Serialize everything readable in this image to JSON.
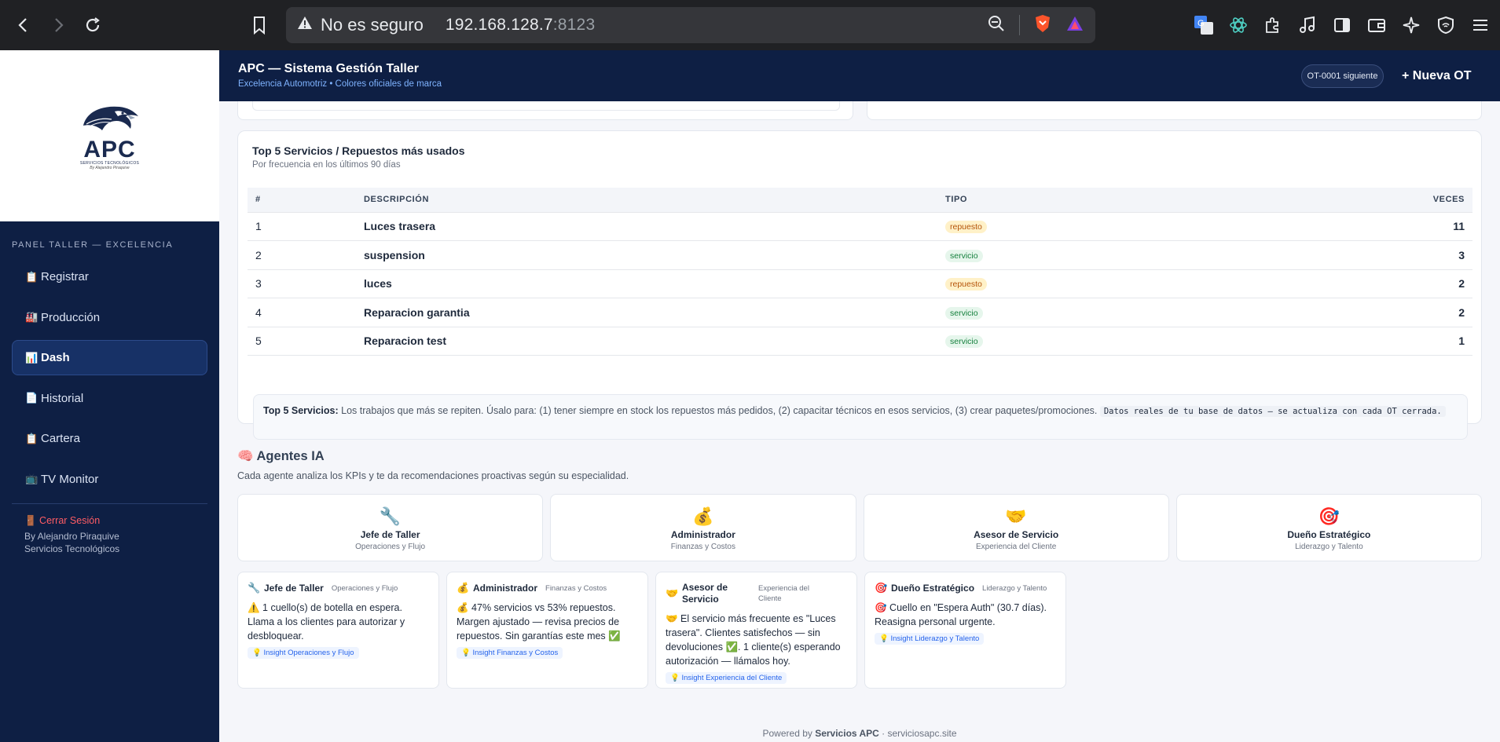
{
  "browser": {
    "insecure_label": "No es seguro",
    "url_host": "192.168.128.7",
    "url_port": ":8123"
  },
  "logo": {
    "text": "APC",
    "sub": "SERVICIOS TECNOLÓGICOS",
    "sign": "By Alejandro Piraquive"
  },
  "sidebar": {
    "section": "PANEL TALLER — EXCELENCIA",
    "items": [
      {
        "icon": "📋",
        "label": "Registrar"
      },
      {
        "icon": "🏭",
        "label": "Producción"
      },
      {
        "icon": "📊",
        "label": "Dash"
      },
      {
        "icon": "📄",
        "label": "Historial"
      },
      {
        "icon": "📋",
        "label": "Cartera"
      },
      {
        "icon": "📺",
        "label": "TV Monitor"
      }
    ],
    "logout": "🚪 Cerrar Sesión",
    "by_line1": "By Alejandro Piraquive",
    "by_line2": "Servicios Tecnológicos"
  },
  "header": {
    "title": "APC — Sistema Gestión Taller",
    "subtitle": "Excelencia Automotriz • Colores oficiales de marca",
    "ot_next": "OT-0001 siguiente",
    "new_ot": "+ Nueva OT"
  },
  "top5": {
    "title": "Top 5 Servicios / Repuestos más usados",
    "subtitle": "Por frecuencia en los últimos 90 días",
    "columns": [
      "#",
      "DESCRIPCIÓN",
      "TIPO",
      "VECES"
    ],
    "rows": [
      {
        "n": "1",
        "desc": "Luces trasera",
        "tipo": "repuesto",
        "veces": "11"
      },
      {
        "n": "2",
        "desc": "suspension",
        "tipo": "servicio",
        "veces": "3"
      },
      {
        "n": "3",
        "desc": "luces",
        "tipo": "repuesto",
        "veces": "2"
      },
      {
        "n": "4",
        "desc": "Reparacion garantia",
        "tipo": "servicio",
        "veces": "2"
      },
      {
        "n": "5",
        "desc": "Reparacion test",
        "tipo": "servicio",
        "veces": "1"
      }
    ],
    "note_label": "Top 5 Servicios:",
    "note_text": " Los trabajos que más se repiten. Úsalo para: (1) tener siempre en stock los repuestos más pedidos, (2) capacitar técnicos en esos servicios, (3) crear paquetes/promociones. ",
    "note_code": "Datos reales de tu base de datos — se actualiza con cada OT cerrada."
  },
  "agents": {
    "title": "🧠 Agentes IA",
    "subtitle": "Cada agente analiza los KPIs y te da recomendaciones proactivas según su especialidad.",
    "cards": [
      {
        "icon": "🔧",
        "name": "Jefe de Taller",
        "desc": "Operaciones y Flujo"
      },
      {
        "icon": "💰",
        "name": "Administrador",
        "desc": "Finanzas y Costos"
      },
      {
        "icon": "🤝",
        "name": "Asesor de Servicio",
        "desc": "Experiencia del Cliente"
      },
      {
        "icon": "🎯",
        "name": "Dueño Estratégico",
        "desc": "Liderazgo y Talento"
      }
    ],
    "insights": [
      {
        "icon": "🔧",
        "name": "Jefe de Taller",
        "desc": "Operaciones y Flujo",
        "body": "⚠️ 1 cuello(s) de botella en espera. Llama a los clientes para autorizar y desbloquear.",
        "tag": "💡 Insight Operaciones y Flujo"
      },
      {
        "icon": "💰",
        "name": "Administrador",
        "desc": "Finanzas y Costos",
        "body": "💰 47% servicios vs 53% repuestos. Margen ajustado — revisa precios de repuestos. Sin garantías este mes ✅",
        "tag": "💡 Insight Finanzas y Costos"
      },
      {
        "icon": "🤝",
        "name": "Asesor de Servicio",
        "desc": "Experiencia del Cliente",
        "body": "🤝 El servicio más frecuente es \"Luces trasera\". Clientes satisfechos — sin devoluciones ✅. 1 cliente(s) esperando autorización — llámalos hoy.",
        "tag": "💡 Insight Experiencia del Cliente"
      },
      {
        "icon": "🎯",
        "name": "Dueño Estratégico",
        "desc": "Liderazgo y Talento",
        "body": "🎯 Cuello en \"Espera Auth\" (30.7 días). Reasigna personal urgente.",
        "tag": "💡 Insight Liderazgo y Talento"
      }
    ]
  },
  "footer": {
    "prefix": "Powered by ",
    "brand": "Servicios APC",
    "suffix": " · serviciosapc.site"
  },
  "colors": {
    "navy": "#0e1f44",
    "accent_blue": "#7fb3ff",
    "repuesto": "#b45309",
    "servicio": "#15803d",
    "logout_red": "#ff5c64"
  }
}
